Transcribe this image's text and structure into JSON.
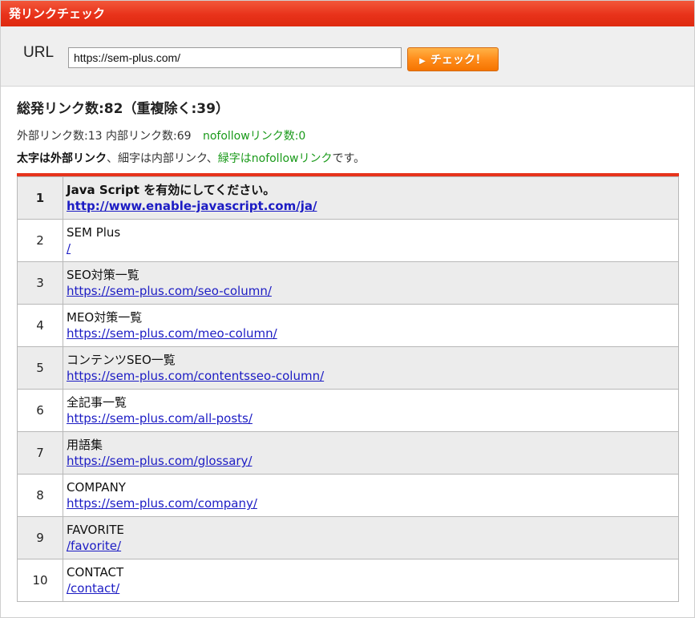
{
  "header": {
    "title": "発リンクチェック"
  },
  "form": {
    "url_label": "URL",
    "url_value": "https://sem-plus.com/",
    "check_button_label": "チェック！"
  },
  "summary": {
    "total_text": "総発リンク数:82（重複除く:39）",
    "external_text": "外部リンク数:13",
    "internal_text": "内部リンク数:69",
    "nofollow_text": "nofollowリンク数:0",
    "legend_bold": "太字は外部リンク",
    "legend_mid": "、細字は内部リンク、",
    "legend_green": "緑字はnofollowリンク",
    "legend_end": "です。"
  },
  "links": [
    {
      "num": "1",
      "title": "Java Script を有効にしてください。",
      "url": "http://www.enable-javascript.com/ja/",
      "external": true
    },
    {
      "num": "2",
      "title": "SEM Plus",
      "url": "/",
      "external": false
    },
    {
      "num": "3",
      "title": "SEO対策一覧",
      "url": "https://sem-plus.com/seo-column/",
      "external": false
    },
    {
      "num": "4",
      "title": "MEO対策一覧",
      "url": "https://sem-plus.com/meo-column/",
      "external": false
    },
    {
      "num": "5",
      "title": "コンテンツSEO一覧",
      "url": "https://sem-plus.com/contentsseo-column/",
      "external": false
    },
    {
      "num": "6",
      "title": "全記事一覧",
      "url": "https://sem-plus.com/all-posts/",
      "external": false
    },
    {
      "num": "7",
      "title": "用語集",
      "url": "https://sem-plus.com/glossary/",
      "external": false
    },
    {
      "num": "8",
      "title": "COMPANY",
      "url": "https://sem-plus.com/company/",
      "external": false
    },
    {
      "num": "9",
      "title": "FAVORITE",
      "url": "/favorite/",
      "external": false
    },
    {
      "num": "10",
      "title": "CONTACT",
      "url": "/contact/",
      "external": false
    }
  ],
  "colors": {
    "header_red": "#e8321a",
    "button_orange": "#ff8c1a",
    "link_blue": "#1c1cc4",
    "nofollow_green": "#1a9a1a"
  }
}
